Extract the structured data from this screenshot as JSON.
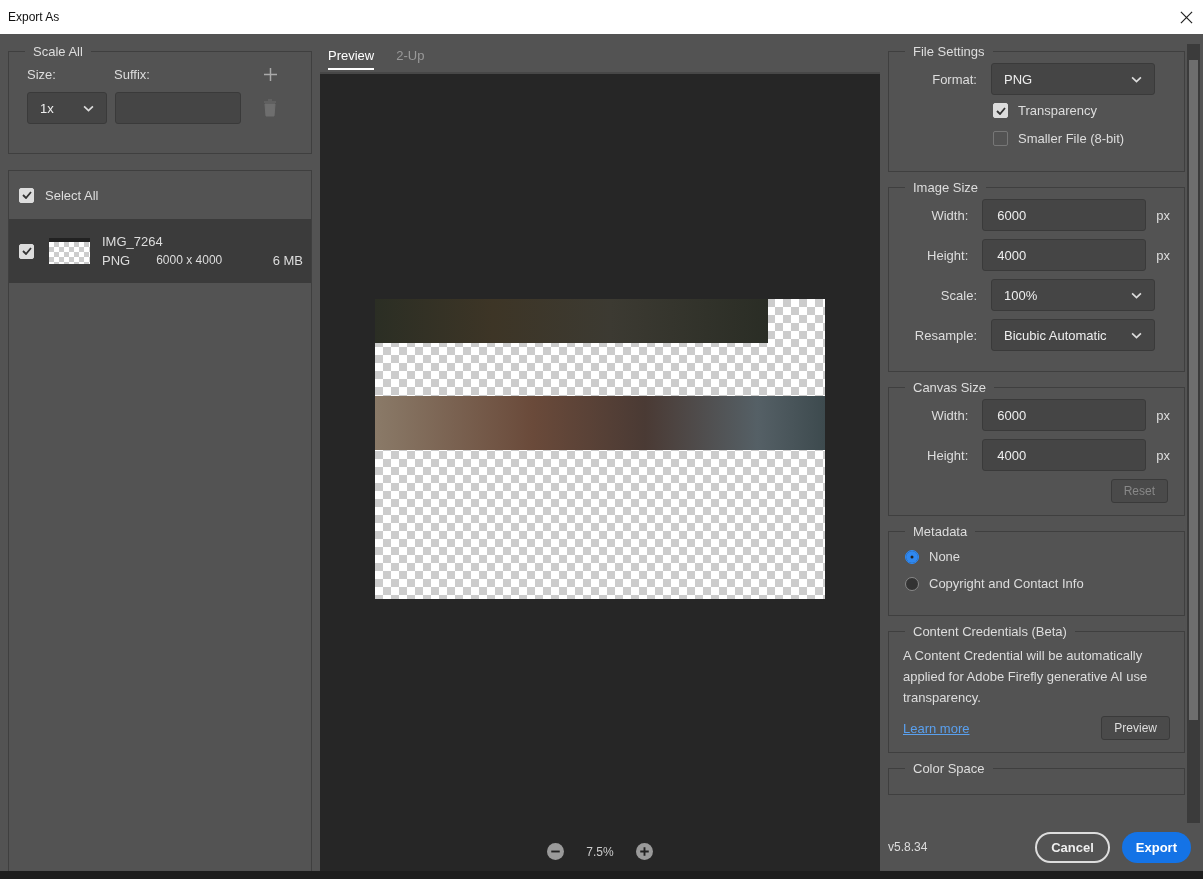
{
  "window": {
    "title": "Export As"
  },
  "scale_all": {
    "title": "Scale All",
    "size_label": "Size:",
    "suffix_label": "Suffix:",
    "size_value": "1x"
  },
  "select_all": {
    "label": "Select All",
    "checked": true
  },
  "files": [
    {
      "name": "IMG_7264",
      "format": "PNG",
      "dimensions": "6000 x 4000",
      "size": "6 MB",
      "checked": true,
      "selected": true
    }
  ],
  "preview": {
    "tabs": [
      {
        "label": "Preview",
        "selected": true
      },
      {
        "label": "2-Up",
        "selected": false
      }
    ],
    "zoom": "7.5%"
  },
  "file_settings": {
    "title": "File Settings",
    "format_label": "Format:",
    "format": "PNG",
    "options": [
      {
        "label": "Transparency",
        "checked": true
      },
      {
        "label": "Smaller File (8-bit)",
        "checked": false
      }
    ]
  },
  "image_size": {
    "title": "Image Size",
    "rows": [
      {
        "kind": "input",
        "label": "Width:",
        "value": "6000",
        "unit": "px"
      },
      {
        "kind": "input",
        "label": "Height:",
        "value": "4000",
        "unit": "px"
      },
      {
        "kind": "select",
        "label": "Scale:",
        "value": "100%"
      },
      {
        "kind": "select",
        "label": "Resample:",
        "value": "Bicubic Automatic"
      }
    ]
  },
  "canvas_size": {
    "title": "Canvas Size",
    "rows": [
      {
        "kind": "input",
        "label": "Width:",
        "value": "6000",
        "unit": "px"
      },
      {
        "kind": "input",
        "label": "Height:",
        "value": "4000",
        "unit": "px"
      }
    ],
    "reset": {
      "label": "Reset",
      "disabled": true
    }
  },
  "metadata": {
    "title": "Metadata",
    "options": [
      {
        "label": "None",
        "selected": true
      },
      {
        "label": "Copyright and Contact Info",
        "selected": false
      }
    ]
  },
  "content_credentials": {
    "title": "Content Credentials (Beta)",
    "text": "A Content Credential will be automatically applied for Adobe Firefly generative AI use transparency.",
    "link": "Learn more",
    "button": "Preview"
  },
  "color_space": {
    "title": "Color Space"
  },
  "version": "v5.8.34",
  "buttons": {
    "cancel": "Cancel",
    "export": "Export"
  }
}
